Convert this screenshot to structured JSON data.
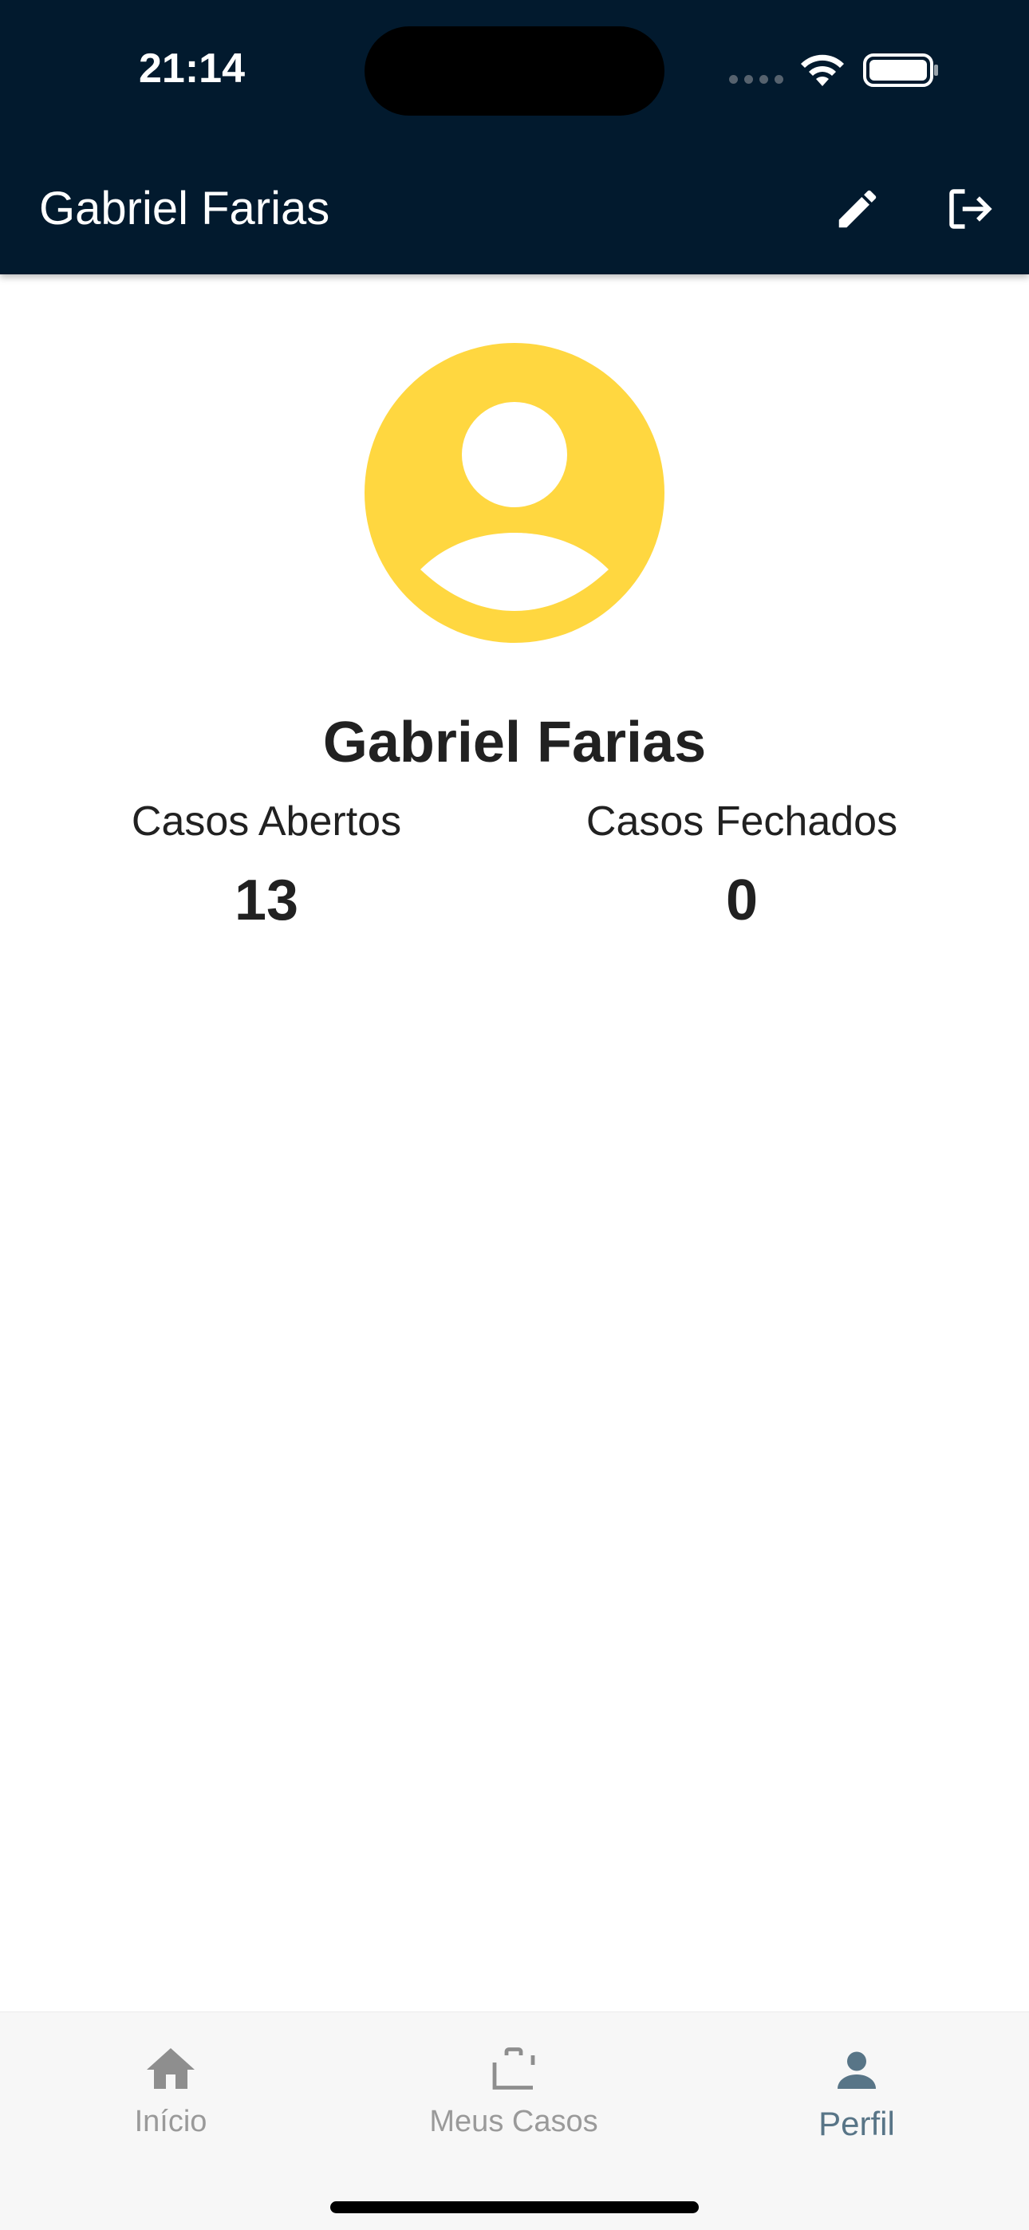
{
  "status_bar": {
    "time": "21:14"
  },
  "app_bar": {
    "title": "Gabriel Farias",
    "actions": [
      {
        "icon": "edit-icon"
      },
      {
        "icon": "logout-icon"
      }
    ]
  },
  "profile": {
    "avatar_icon": "person-avatar-icon",
    "avatar_color": "#FFD740",
    "name": "Gabriel Farias",
    "stats": [
      {
        "label": "Casos Abertos",
        "value": "13"
      },
      {
        "label": "Casos Fechados",
        "value": "0"
      }
    ]
  },
  "bottom_nav": {
    "items": [
      {
        "label": "Início",
        "icon": "home-icon",
        "active": false
      },
      {
        "label": "Meus Casos",
        "icon": "briefcase-icon",
        "active": false
      },
      {
        "label": "Perfil",
        "icon": "person-icon",
        "active": true
      }
    ]
  },
  "colors": {
    "header_bg": "#021A2E",
    "active_nav": "#587587",
    "inactive_nav": "#9A9A9A"
  }
}
